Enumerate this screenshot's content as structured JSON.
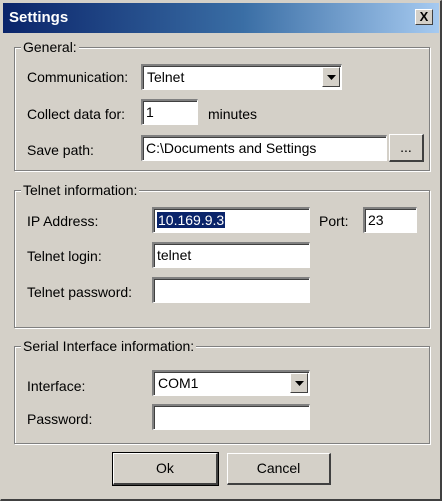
{
  "window": {
    "title": "Settings",
    "close_glyph": "X"
  },
  "general": {
    "legend": "General:",
    "communication_label": "Communication:",
    "communication_value": "Telnet",
    "collect_label": "Collect data for:",
    "collect_value": "1",
    "collect_unit": "minutes",
    "save_path_label": "Save path:",
    "save_path_value": "C:\\Documents and Settings",
    "browse_label": "..."
  },
  "telnet": {
    "legend": "Telnet information:",
    "ip_label": "IP Address:",
    "ip_value": "10.169.9.3",
    "port_label": "Port:",
    "port_value": "23",
    "login_label": "Telnet login:",
    "login_value": "telnet",
    "password_label": "Telnet password:",
    "password_value": ""
  },
  "serial": {
    "legend": "Serial Interface information:",
    "interface_label": "Interface:",
    "interface_value": "COM1",
    "password_label": "Password:",
    "password_value": ""
  },
  "buttons": {
    "ok": "Ok",
    "cancel": "Cancel"
  }
}
